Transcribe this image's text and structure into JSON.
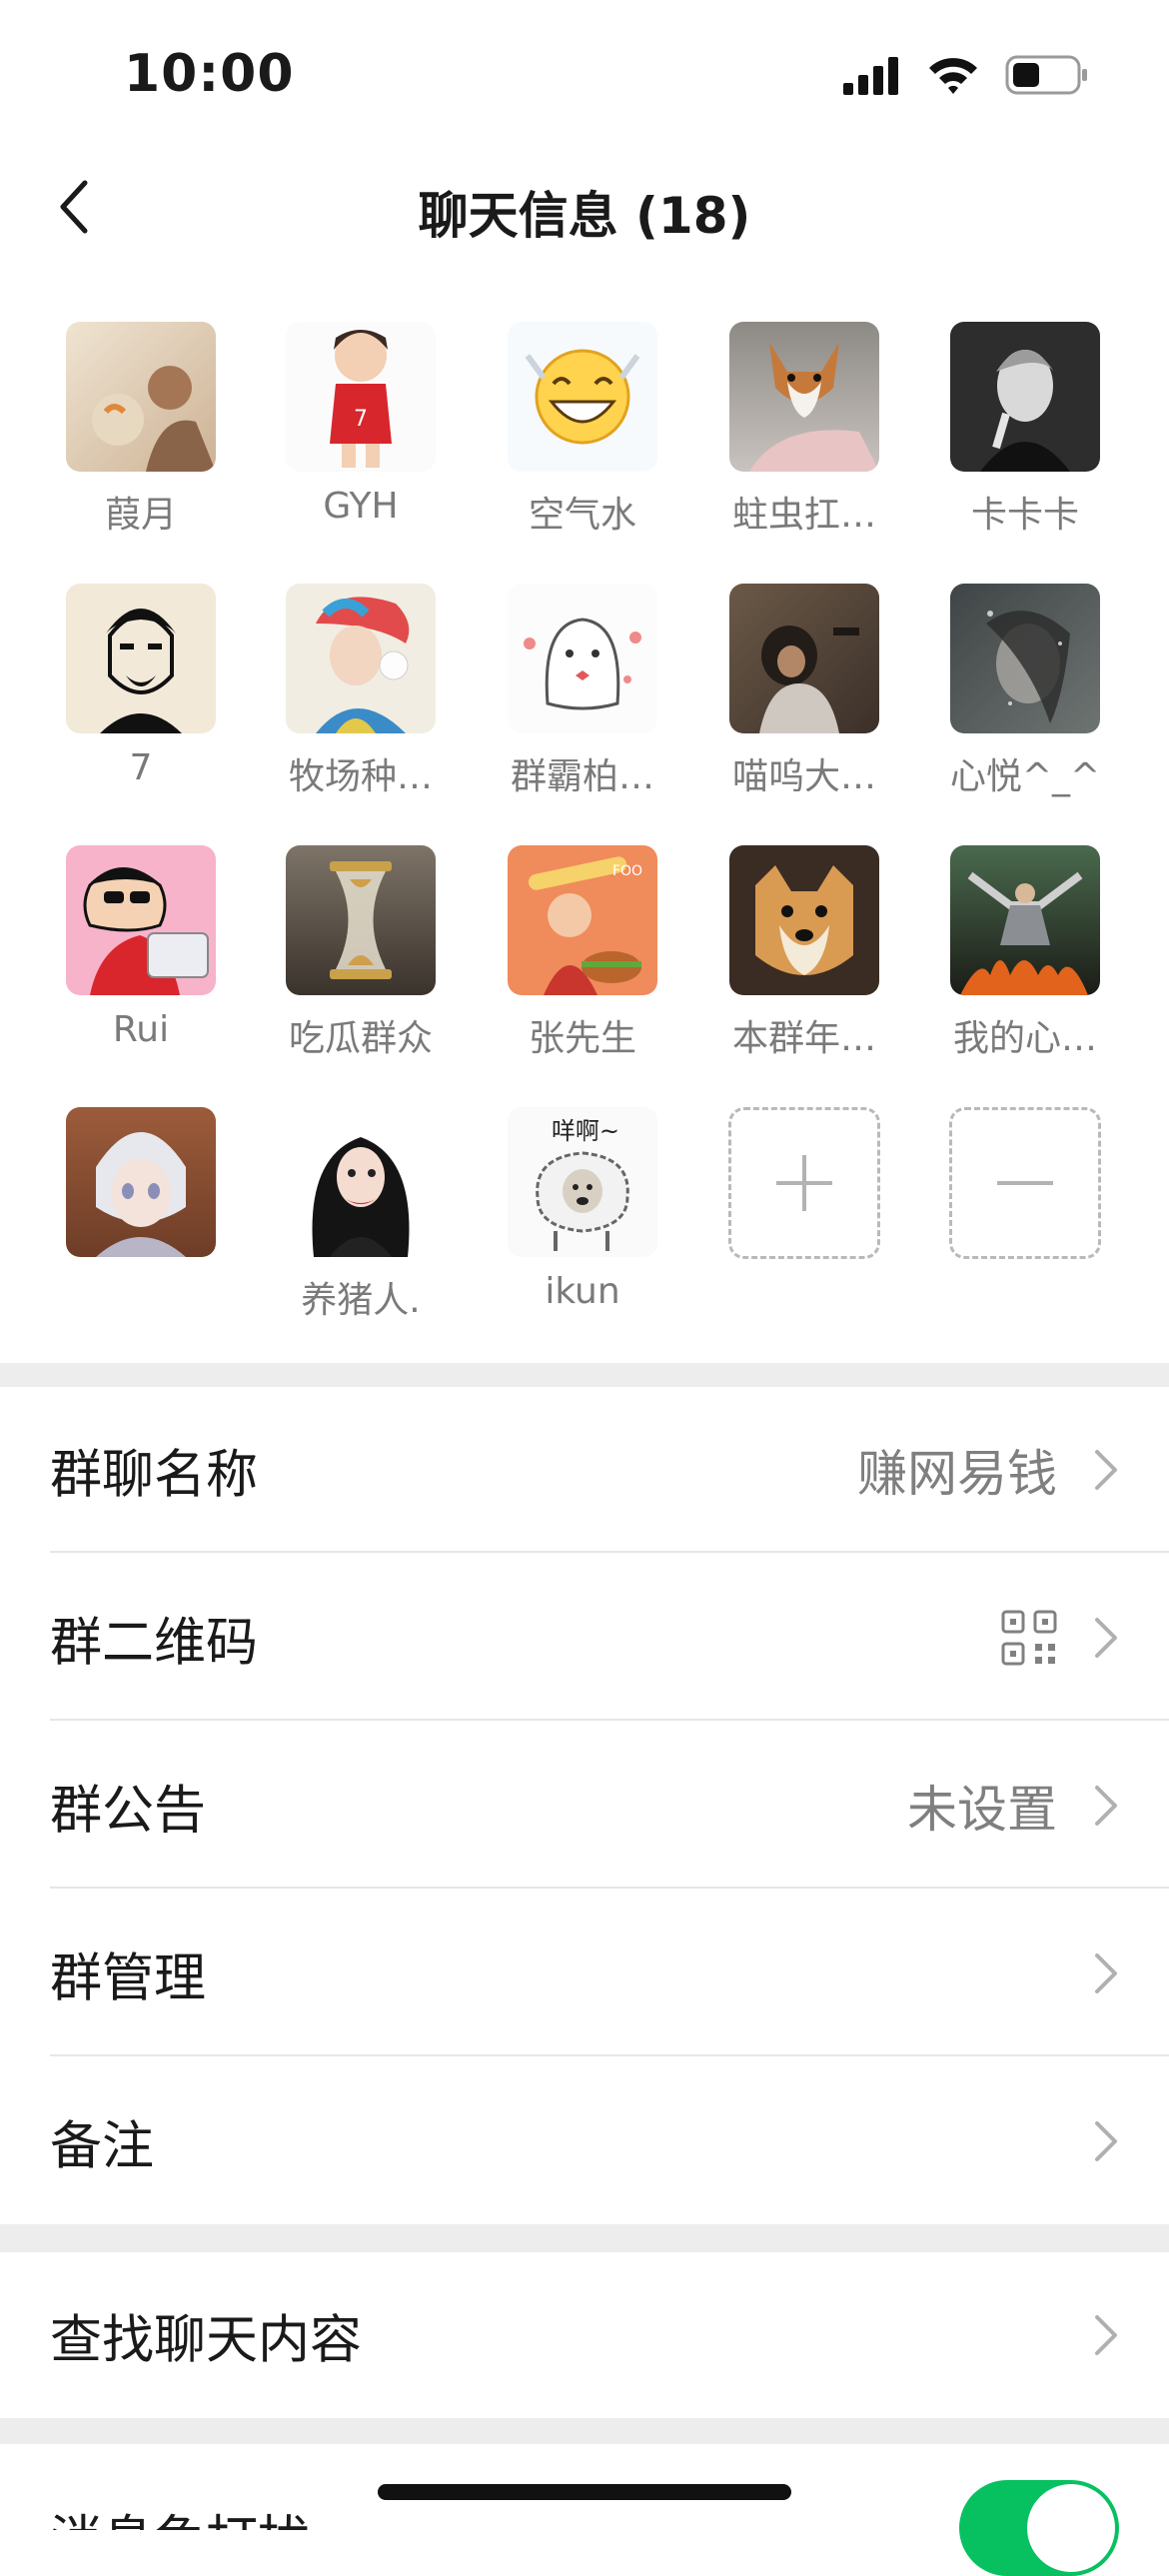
{
  "status_bar": {
    "time": "10:00"
  },
  "nav": {
    "title": "聊天信息 (18)"
  },
  "members": [
    {
      "name": "葭月",
      "avatar": "boy-fishbowl"
    },
    {
      "name": "GYH",
      "avatar": "cartoon-footballer"
    },
    {
      "name": "空气水",
      "avatar": "smiley-sticker"
    },
    {
      "name": "蛀虫扛…",
      "avatar": "corgi-dog"
    },
    {
      "name": "卡卡卡",
      "avatar": "bw-portrait"
    },
    {
      "name": "7",
      "avatar": "sketch-face"
    },
    {
      "name": "牧场种…",
      "avatar": "anime-boy"
    },
    {
      "name": "群霸柏…",
      "avatar": "ghost-sticker"
    },
    {
      "name": "喵呜大…",
      "avatar": "monkey"
    },
    {
      "name": "心悦^_^",
      "avatar": "blurry-girl"
    },
    {
      "name": "Rui",
      "avatar": "crayon-shin"
    },
    {
      "name": "吃瓜群众",
      "avatar": "hourglass"
    },
    {
      "name": "张先生",
      "avatar": "baby-food"
    },
    {
      "name": "本群年…",
      "avatar": "shiba-dog"
    },
    {
      "name": "我的心…",
      "avatar": "man-fire"
    },
    {
      "name": "",
      "avatar": "anime-white-hair"
    },
    {
      "name": "养猪人.",
      "avatar": "anime-girl"
    },
    {
      "name": "ikun",
      "avatar": "meme-sheep"
    }
  ],
  "member_actions": {
    "add_icon": "plus-icon",
    "remove_icon": "minus-icon"
  },
  "meme_text": "咩啊~",
  "settings": {
    "group_name": {
      "label": "群聊名称",
      "value": "赚网易钱"
    },
    "qr_code": {
      "label": "群二维码",
      "icon": "qr-code-icon"
    },
    "announcement": {
      "label": "群公告",
      "value": "未设置"
    },
    "manage": {
      "label": "群管理"
    },
    "remark": {
      "label": "备注"
    },
    "search": {
      "label": "查找聊天内容"
    },
    "mute": {
      "label": "消息免打扰"
    }
  },
  "colors": {
    "accent_green": "#07c160",
    "background_gray": "#ededed"
  }
}
